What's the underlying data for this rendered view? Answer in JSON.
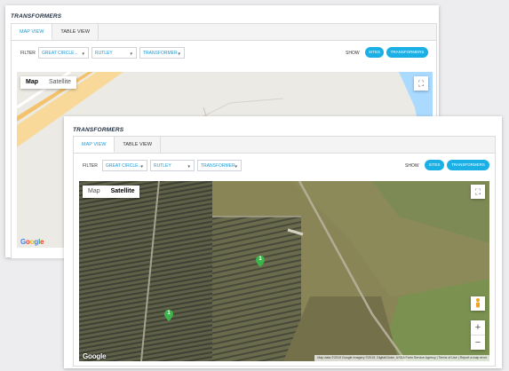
{
  "back_panel": {
    "title": "TRANSFORMERS",
    "tabs": [
      {
        "label": "MAP VIEW",
        "active": true
      },
      {
        "label": "TABLE VIEW",
        "active": false
      }
    ],
    "filter_label": "FILTER",
    "filters": [
      {
        "value": "GREAT CIRCLE..."
      },
      {
        "value": "RUTLEY"
      },
      {
        "value": "TRANSFORMER"
      }
    ],
    "show_label": "SHOW",
    "show_buttons": [
      "SITES",
      "TRANSFORMERS"
    ],
    "map": {
      "toggle": {
        "map": "Map",
        "satellite": "Satellite",
        "active": "map"
      },
      "google": "Google"
    }
  },
  "front_panel": {
    "title": "TRANSFORMERS",
    "tabs": [
      {
        "label": "MAP VIEW",
        "active": true
      },
      {
        "label": "TABLE VIEW",
        "active": false
      }
    ],
    "filter_label": "FILTER",
    "filters": [
      {
        "value": "GREAT CIRCLE..."
      },
      {
        "value": "RUTLEY"
      },
      {
        "value": "TRANSFORMER"
      }
    ],
    "show_label": "SHOW",
    "show_buttons": [
      "SITES",
      "TRANSFORMERS"
    ],
    "map": {
      "toggle": {
        "map": "Map",
        "satellite": "Satellite",
        "active": "satellite"
      },
      "google": "Google",
      "attribution": "Map data ©2019 Google Imagery ©2019, DigitalGlobe, USDA Farm Service Agency | Terms of Use | Report a map error",
      "markers": [
        "1",
        "1"
      ]
    }
  },
  "colors": {
    "accent": "#1ab0e6",
    "tab_active": "#1a9bd7",
    "marker": "#3cb44b"
  },
  "icons": [
    "fullscreen-icon",
    "pegman-icon",
    "zoom-in-icon",
    "zoom-out-icon",
    "chevron-down-icon",
    "map-marker-icon"
  ]
}
